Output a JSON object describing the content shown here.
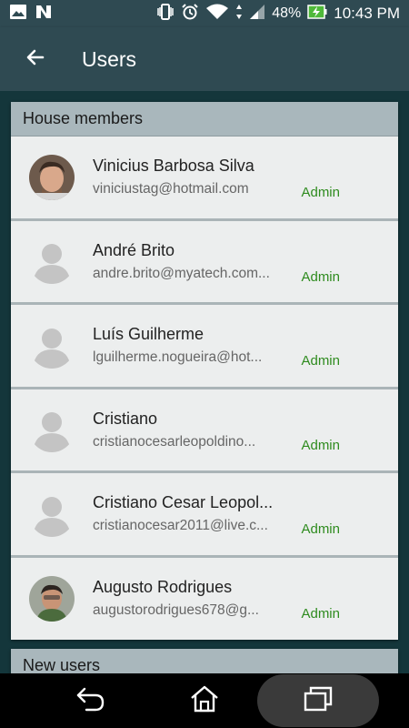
{
  "status_bar": {
    "battery": "48%",
    "time": "10:43 PM",
    "icons": [
      "image-icon",
      "n-icon",
      "vibrate-icon",
      "alarm-icon",
      "wifi-icon",
      "signal-icon",
      "battery-charging-icon"
    ]
  },
  "app_bar": {
    "title": "Users"
  },
  "house_members": {
    "header": "House members",
    "users": [
      {
        "name": "Vinicius Barbosa Silva",
        "email": "viniciustag@hotmail.com",
        "role": "Admin",
        "avatar": "photo-1"
      },
      {
        "name": "André Brito",
        "email": "andre.brito@myatech.com...",
        "role": "Admin",
        "avatar": "placeholder"
      },
      {
        "name": "Luís Guilherme",
        "email": "lguilherme.nogueira@hot...",
        "role": "Admin",
        "avatar": "placeholder"
      },
      {
        "name": "Cristiano",
        "email": "cristianocesarleopoldino...",
        "role": "Admin",
        "avatar": "placeholder"
      },
      {
        "name": "Cristiano Cesar Leopol...",
        "email": "cristianocesar2011@live.c...",
        "role": "Admin",
        "avatar": "placeholder"
      },
      {
        "name": "Augusto Rodrigues",
        "email": "augustorodrigues678@g...",
        "role": "Admin",
        "avatar": "photo-2"
      }
    ]
  },
  "new_users": {
    "header": "New users"
  },
  "colors": {
    "app_bar": "#2f4a52",
    "content_bg": "#14363b",
    "admin_green": "#2e8b1e"
  }
}
